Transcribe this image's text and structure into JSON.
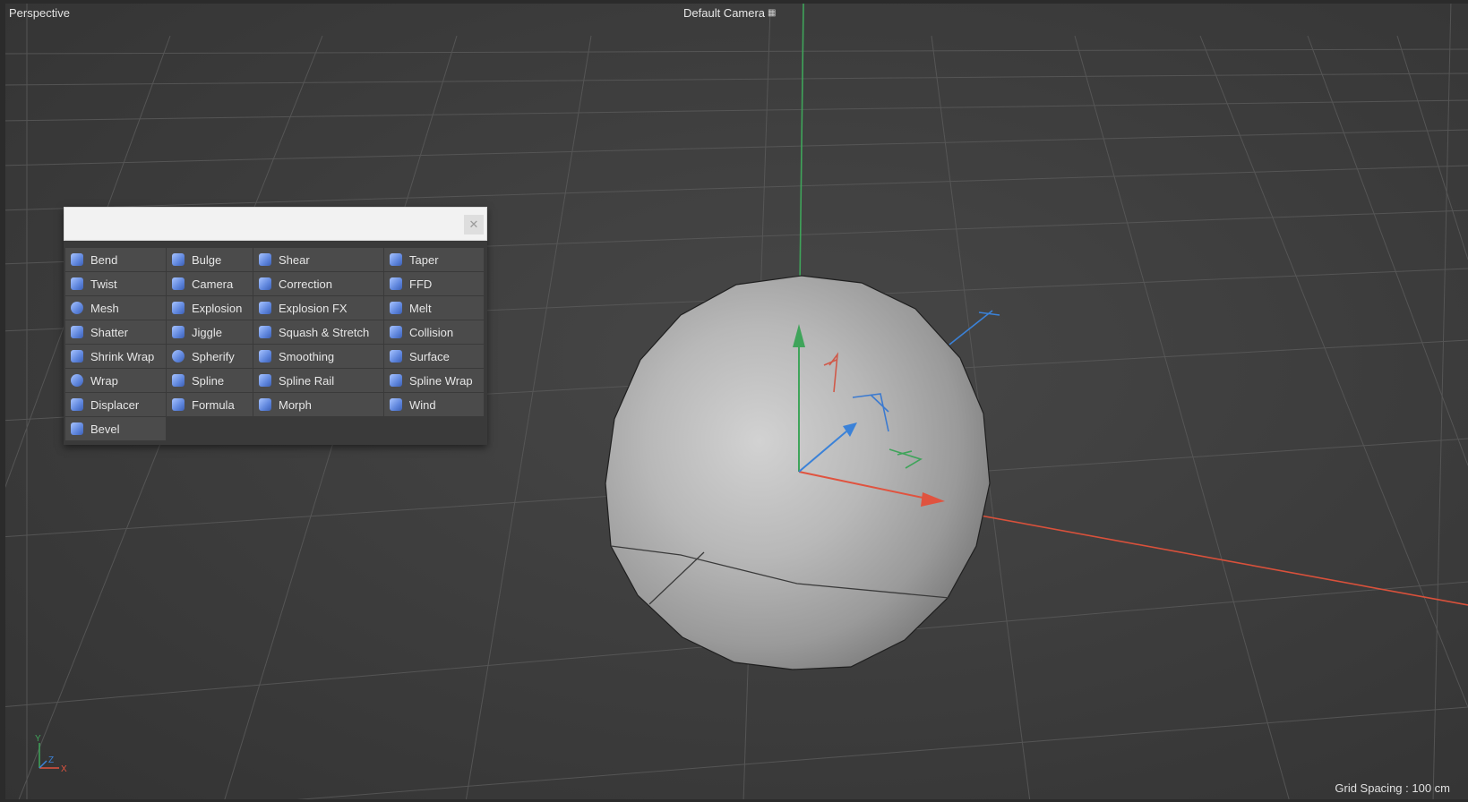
{
  "viewport": {
    "view_name": "Perspective",
    "camera": "Default Camera",
    "camera_icon": "camera-link-icon",
    "grid_spacing": "Grid Spacing : 100 cm"
  },
  "axis_gizmo": {
    "x": "X",
    "y": "Y",
    "z": "Z"
  },
  "deformer_popup": {
    "search_value": "",
    "close_icon": "close-icon",
    "items": [
      {
        "label": "Bend",
        "icon": "bend-icon"
      },
      {
        "label": "Bulge",
        "icon": "bulge-icon"
      },
      {
        "label": "Shear",
        "icon": "shear-icon"
      },
      {
        "label": "Taper",
        "icon": "taper-icon"
      },
      {
        "label": "Twist",
        "icon": "twist-icon"
      },
      {
        "label": "Camera",
        "icon": "camera-deformer-icon"
      },
      {
        "label": "Correction",
        "icon": "correction-icon"
      },
      {
        "label": "FFD",
        "icon": "ffd-icon"
      },
      {
        "label": "Mesh",
        "icon": "mesh-icon"
      },
      {
        "label": "Explosion",
        "icon": "explosion-icon"
      },
      {
        "label": "Explosion FX",
        "icon": "explosion-fx-icon"
      },
      {
        "label": "Melt",
        "icon": "melt-icon"
      },
      {
        "label": "Shatter",
        "icon": "shatter-icon"
      },
      {
        "label": "Jiggle",
        "icon": "jiggle-icon"
      },
      {
        "label": "Squash & Stretch",
        "icon": "squash-stretch-icon"
      },
      {
        "label": "Collision",
        "icon": "collision-icon"
      },
      {
        "label": "Shrink Wrap",
        "icon": "shrink-wrap-icon"
      },
      {
        "label": "Spherify",
        "icon": "spherify-icon"
      },
      {
        "label": "Smoothing",
        "icon": "smoothing-icon"
      },
      {
        "label": "Surface",
        "icon": "surface-icon"
      },
      {
        "label": "Wrap",
        "icon": "wrap-icon"
      },
      {
        "label": "Spline",
        "icon": "spline-icon"
      },
      {
        "label": "Spline Rail",
        "icon": "spline-rail-icon"
      },
      {
        "label": "Spline Wrap",
        "icon": "spline-wrap-icon"
      },
      {
        "label": "Displacer",
        "icon": "displacer-icon"
      },
      {
        "label": "Formula",
        "icon": "formula-icon"
      },
      {
        "label": "Morph",
        "icon": "morph-icon"
      },
      {
        "label": "Wind",
        "icon": "wind-icon"
      },
      {
        "label": "Bevel",
        "icon": "bevel-icon"
      }
    ]
  },
  "colors": {
    "axis_x": "#e0533f",
    "axis_y": "#3fa45a",
    "axis_z": "#3b82d8",
    "icon_blue": "#5f86dd"
  }
}
